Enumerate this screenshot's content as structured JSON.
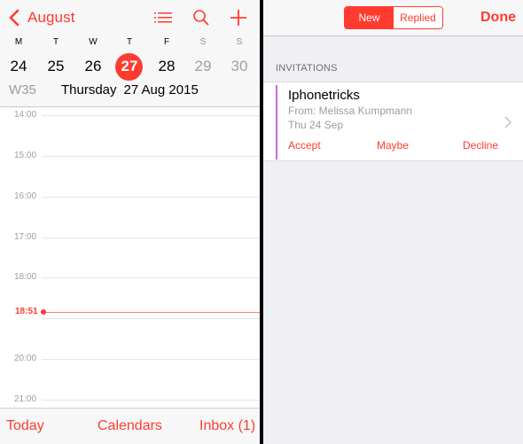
{
  "calendar": {
    "back_label": "August",
    "icons": {
      "back": "chevron-left-icon",
      "list": "list-icon",
      "search": "search-icon",
      "add": "plus-icon"
    },
    "weekdays": [
      "M",
      "T",
      "W",
      "T",
      "F",
      "S",
      "S"
    ],
    "dates": [
      "24",
      "25",
      "26",
      "27",
      "28",
      "29",
      "30"
    ],
    "selected_index": 3,
    "week_number": "W35",
    "selected_weekday": "Thursday",
    "selected_date": "27 Aug 2015",
    "hours": [
      "14:00",
      "15:00",
      "16:00",
      "17:00",
      "18:00",
      "",
      "20:00",
      "21:00"
    ],
    "current_time": "18:51",
    "accent_color": "#ff3b30"
  },
  "tabbar": {
    "today": "Today",
    "calendars": "Calendars",
    "inbox": "Inbox (1)"
  },
  "inbox": {
    "segments": [
      "New",
      "Replied"
    ],
    "active_segment": "New",
    "done_label": "Done",
    "section_header": "INVITATIONS",
    "invitations": [
      {
        "title": "Iphonetricks",
        "from": "From: Melissa Kumpmann",
        "date": "Thu 24 Sep",
        "calendar_color": "#c969e0",
        "actions": [
          "Accept",
          "Maybe",
          "Decline"
        ]
      }
    ]
  }
}
